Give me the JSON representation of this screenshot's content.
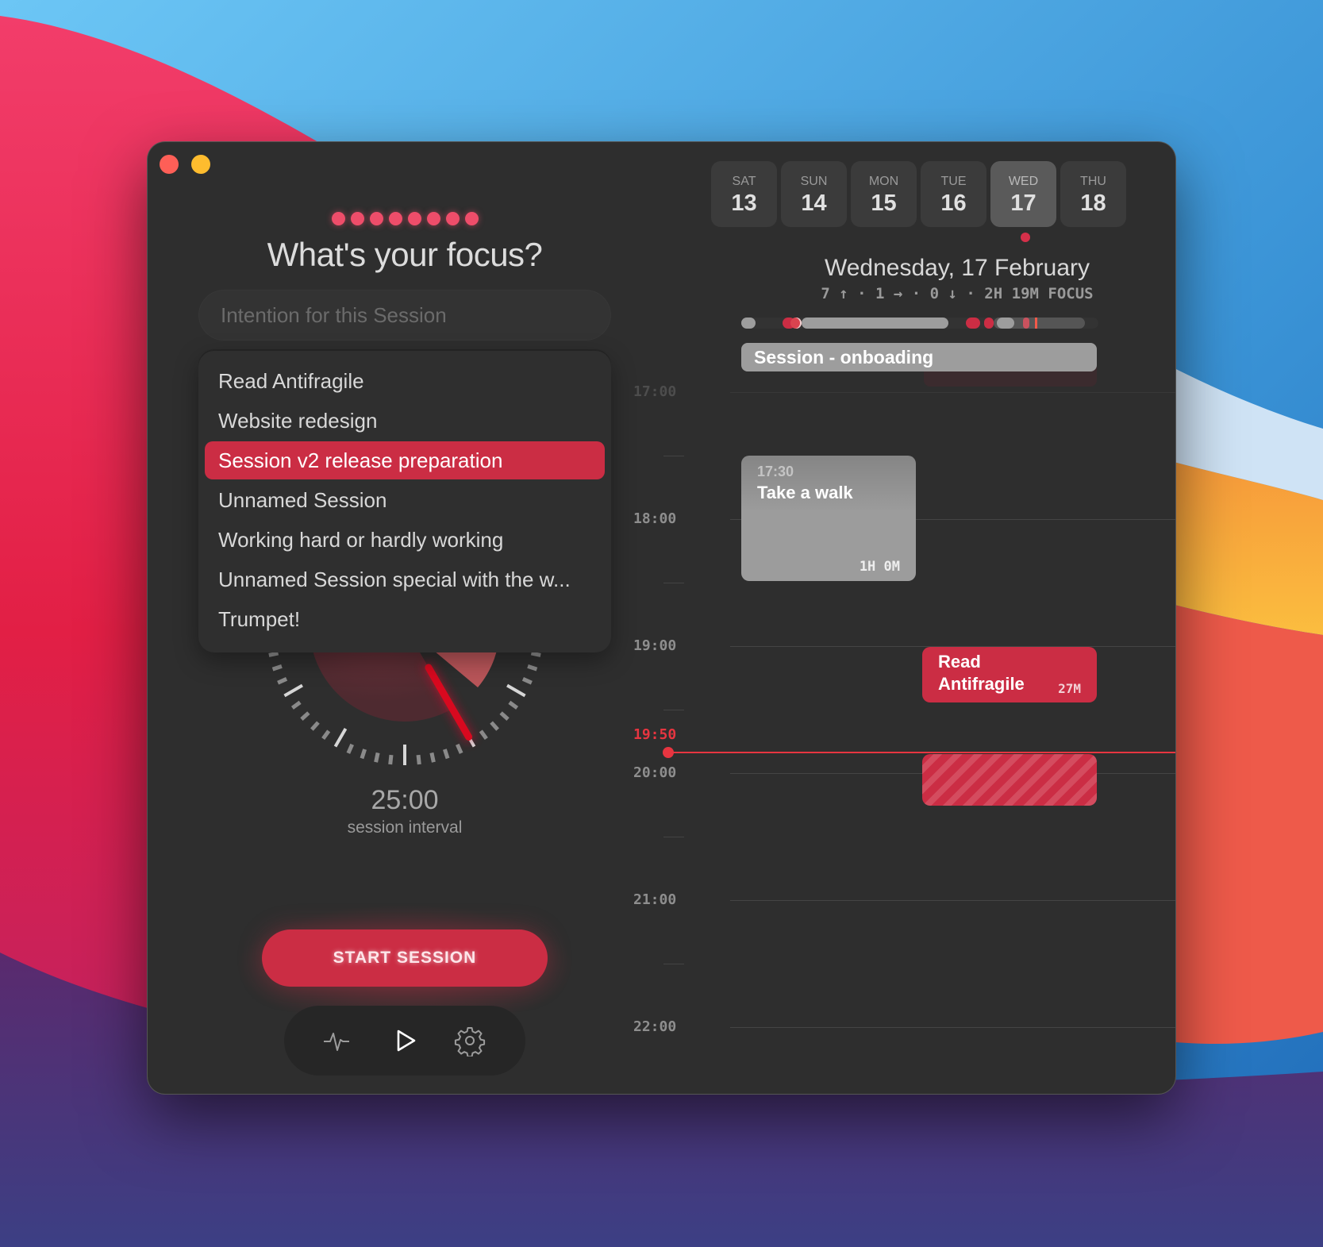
{
  "window": {
    "controls": [
      "close",
      "minimize"
    ]
  },
  "focus": {
    "progress_dots": 8,
    "title": "What's your focus?",
    "intention_placeholder": "Intention for this Session",
    "intention_value": "",
    "suggestions": [
      {
        "label": "Read Antifragile",
        "selected": false
      },
      {
        "label": "Website redesign",
        "selected": false
      },
      {
        "label": "Session v2 release preparation",
        "selected": true
      },
      {
        "label": "Unnamed Session",
        "selected": false
      },
      {
        "label": "Working hard or hardly working",
        "selected": false
      },
      {
        "label": "Unnamed Session special with the w...",
        "selected": false
      },
      {
        "label": "Trumpet!",
        "selected": false
      }
    ]
  },
  "timer": {
    "value": "25:00",
    "label": "session interval",
    "minutes": 25
  },
  "actions": {
    "start_label": "START SESSION",
    "toolbar": [
      {
        "icon": "activity-pulse-icon",
        "label": "Activity"
      },
      {
        "icon": "play-icon",
        "label": "Play"
      },
      {
        "icon": "gear-icon",
        "label": "Settings"
      }
    ]
  },
  "calendar": {
    "days": [
      {
        "dow": "SAT",
        "num": "13",
        "active": false
      },
      {
        "dow": "SUN",
        "num": "14",
        "active": false
      },
      {
        "dow": "MON",
        "num": "15",
        "active": false
      },
      {
        "dow": "TUE",
        "num": "16",
        "active": false
      },
      {
        "dow": "WED",
        "num": "17",
        "active": true
      },
      {
        "dow": "THU",
        "num": "18",
        "active": false
      }
    ],
    "date_title": "Wednesday, 17 February",
    "stats": "7 ↑ · 1 → · 0 ↓ · 2H 19M FOCUS",
    "all_day_event": "Session - onboading",
    "hours": [
      "17:00",
      "18:00",
      "19:00",
      "20:00",
      "21:00",
      "22:00"
    ],
    "events": [
      {
        "start": "17:30",
        "title": "Take a walk",
        "duration": "1H 0M",
        "kind": "break"
      },
      {
        "start": "19:00",
        "title": "Read Antifragile",
        "duration": "27M",
        "kind": "session"
      },
      {
        "start": "19:50",
        "title": "",
        "duration": "",
        "kind": "in-progress"
      }
    ],
    "now": "19:50"
  },
  "colors": {
    "accent": "#cb2d44",
    "now": "#e73540",
    "break": "#9d9d9d",
    "window_bg": "#2e2e2e"
  }
}
